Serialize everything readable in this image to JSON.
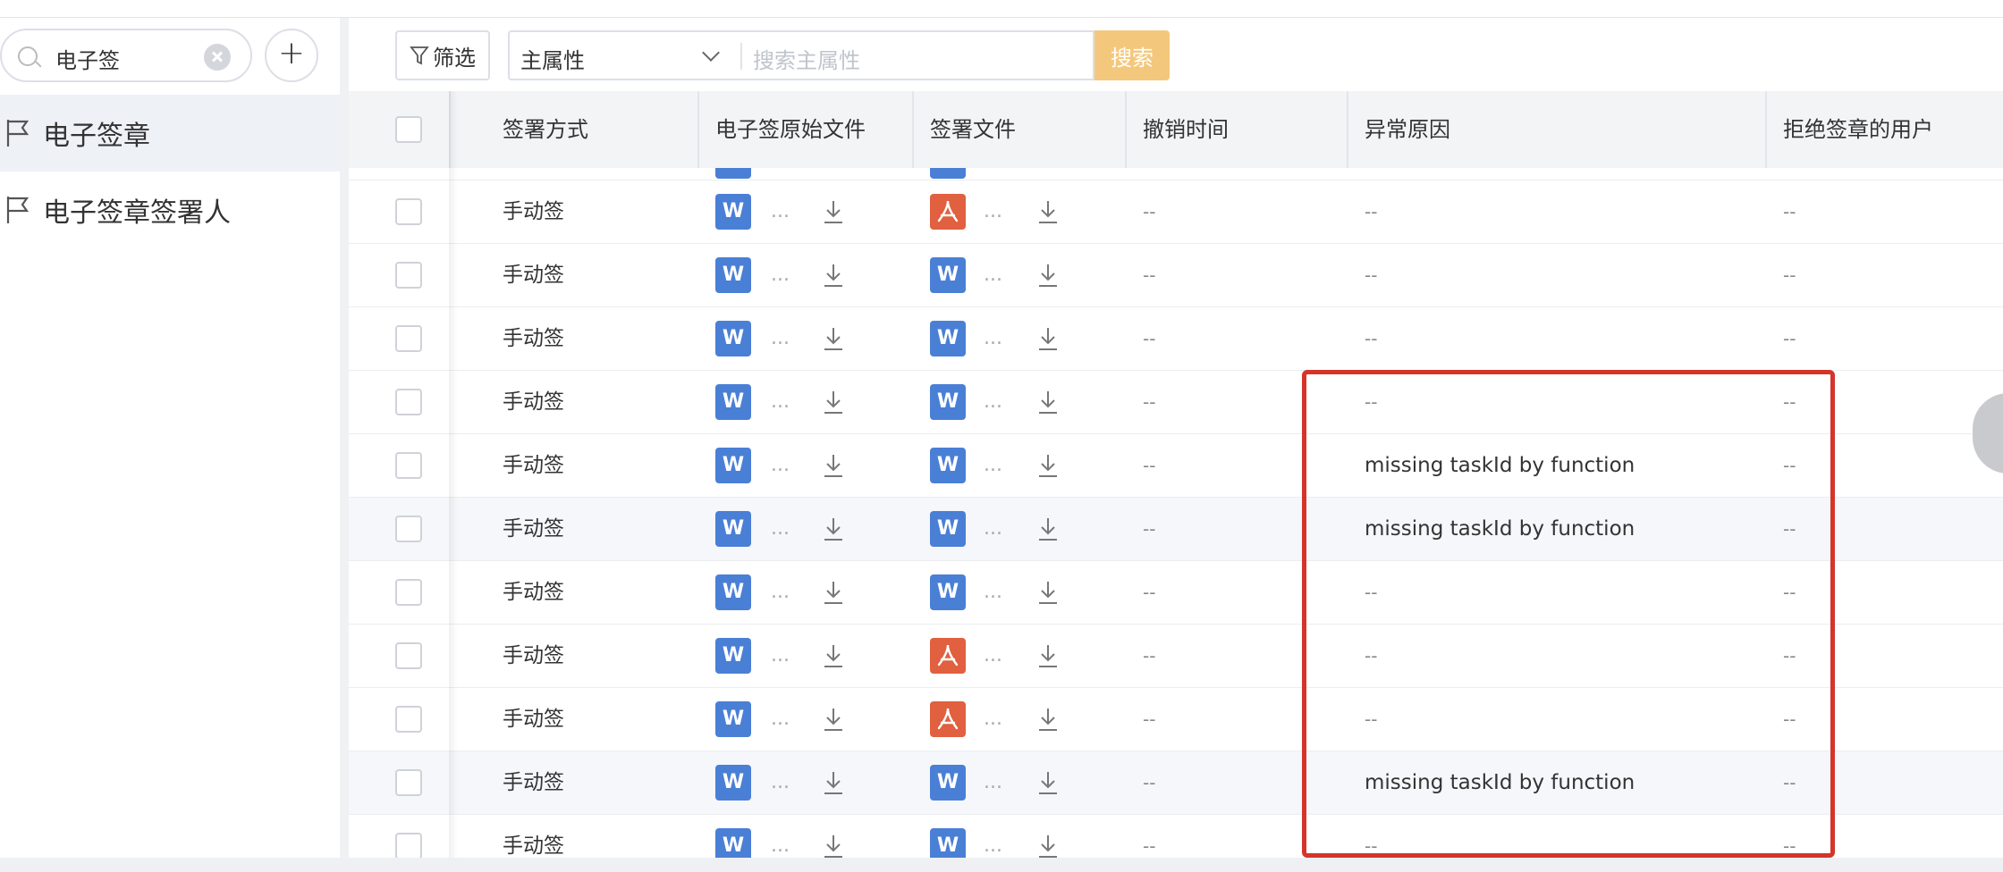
{
  "sidebar": {
    "search_value": "电子签",
    "add_label": "+",
    "items": [
      {
        "label": "电子签章",
        "active": true
      },
      {
        "label": "电子签章签署人",
        "active": false
      }
    ]
  },
  "toolbar": {
    "filter_label": "筛选",
    "attr_select_value": "主属性",
    "attr_input_placeholder": "搜索主属性",
    "search_label": "搜索"
  },
  "table": {
    "columns": [
      "签署方式",
      "电子签原始文件",
      "签署文件",
      "撤销时间",
      "异常原因",
      "拒绝签章的用户"
    ],
    "rows": [
      {
        "method": "手动签",
        "orig_file": "word",
        "sign_file": "pdf",
        "revoke_time": "--",
        "error": "--",
        "reject_user": "--"
      },
      {
        "method": "手动签",
        "orig_file": "word",
        "sign_file": "word",
        "revoke_time": "--",
        "error": "--",
        "reject_user": "--"
      },
      {
        "method": "手动签",
        "orig_file": "word",
        "sign_file": "word",
        "revoke_time": "--",
        "error": "--",
        "reject_user": "--"
      },
      {
        "method": "手动签",
        "orig_file": "word",
        "sign_file": "word",
        "revoke_time": "--",
        "error": "--",
        "reject_user": "--"
      },
      {
        "method": "手动签",
        "orig_file": "word",
        "sign_file": "word",
        "revoke_time": "--",
        "error": "missing taskId by function",
        "reject_user": "--"
      },
      {
        "method": "手动签",
        "orig_file": "word",
        "sign_file": "word",
        "revoke_time": "--",
        "error": "missing taskId by function",
        "reject_user": "--"
      },
      {
        "method": "手动签",
        "orig_file": "word",
        "sign_file": "word",
        "revoke_time": "--",
        "error": "--",
        "reject_user": "--"
      },
      {
        "method": "手动签",
        "orig_file": "word",
        "sign_file": "pdf",
        "revoke_time": "--",
        "error": "--",
        "reject_user": "--"
      },
      {
        "method": "手动签",
        "orig_file": "word",
        "sign_file": "pdf",
        "revoke_time": "--",
        "error": "--",
        "reject_user": "--"
      },
      {
        "method": "手动签",
        "orig_file": "word",
        "sign_file": "word",
        "revoke_time": "--",
        "error": "missing taskId by function",
        "reject_user": "--"
      },
      {
        "method": "手动签",
        "orig_file": "word",
        "sign_file": "word",
        "revoke_time": "--",
        "error": "--",
        "reject_user": "--"
      }
    ],
    "file_icon_letter": "W",
    "ellipsis": "..."
  },
  "colors": {
    "accent_search": "#f4c87c",
    "word_icon": "#4a7fd6",
    "pdf_icon": "#e0603f",
    "highlight": "#d4352a"
  }
}
